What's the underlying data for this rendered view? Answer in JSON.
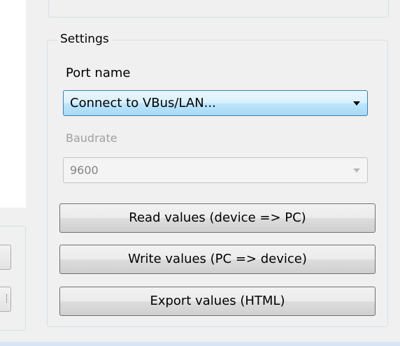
{
  "settings": {
    "group_title": "Settings",
    "port_label": "Port name",
    "port_value": "Connect to VBus/LAN...",
    "baud_label": "Baudrate",
    "baud_value": "9600"
  },
  "buttons": {
    "read": "Read values (device => PC)",
    "write": "Write values (PC => device)",
    "export": "Export values (HTML)"
  },
  "icons": {
    "port_dropdown": "chevron-down-icon",
    "baud_dropdown": "chevron-down-icon"
  }
}
